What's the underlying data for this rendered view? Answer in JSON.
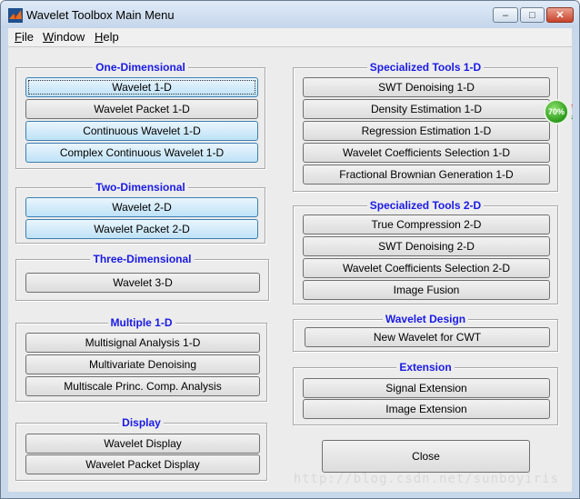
{
  "window": {
    "title": "Wavelet Toolbox Main Menu",
    "controls": {
      "minimize": "–",
      "maximize": "□",
      "close": "✕"
    }
  },
  "menubar": {
    "file": {
      "mnemonic": "F",
      "rest": "ile"
    },
    "window": {
      "mnemonic": "W",
      "rest": "indow"
    },
    "help": {
      "mnemonic": "H",
      "rest": "elp"
    }
  },
  "panels": {
    "one_d": {
      "title": "One-Dimensional",
      "buttons": [
        "Wavelet 1-D",
        "Wavelet Packet 1-D",
        "Continuous Wavelet 1-D",
        "Complex Continuous Wavelet 1-D"
      ]
    },
    "two_d": {
      "title": "Two-Dimensional",
      "buttons": [
        "Wavelet 2-D",
        "Wavelet Packet 2-D"
      ]
    },
    "three_d": {
      "title": "Three-Dimensional",
      "buttons": [
        "Wavelet 3-D"
      ]
    },
    "multiple_1d": {
      "title": "Multiple 1-D",
      "buttons": [
        "Multisignal Analysis 1-D",
        "Multivariate Denoising",
        "Multiscale Princ. Comp. Analysis"
      ]
    },
    "display": {
      "title": "Display",
      "buttons": [
        "Wavelet Display",
        "Wavelet Packet Display"
      ]
    },
    "spec_1d": {
      "title": "Specialized Tools 1-D",
      "buttons": [
        "SWT Denoising 1-D",
        "Density Estimation 1-D",
        "Regression Estimation 1-D",
        "Wavelet Coefficients Selection 1-D",
        "Fractional Brownian Generation 1-D"
      ]
    },
    "spec_2d": {
      "title": "Specialized Tools 2-D",
      "buttons": [
        "True Compression 2-D",
        "SWT Denoising 2-D",
        "Wavelet Coefficients Selection 2-D",
        "Image Fusion"
      ]
    },
    "design": {
      "title": "Wavelet Design",
      "buttons": [
        "New Wavelet for CWT"
      ]
    },
    "extension": {
      "title": "Extension",
      "buttons": [
        "Signal Extension",
        "Image Extension"
      ]
    }
  },
  "close_button": "Close",
  "overlay": {
    "percent": "70%",
    "up": "↑",
    "down": "↓"
  },
  "watermark": "http://blog.csdn.net/sunboyiris",
  "colors": {
    "panel_title": "#1a1ae6",
    "highlight": "#bfe2f7",
    "badge": "#2b9a1c"
  }
}
